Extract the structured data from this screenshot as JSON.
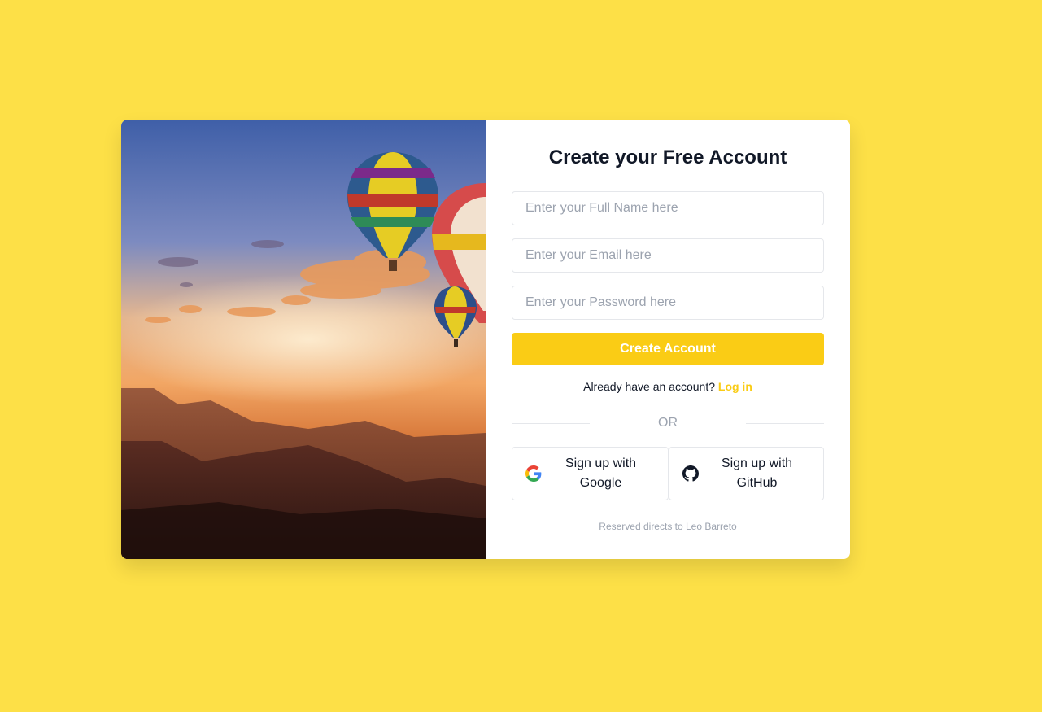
{
  "form": {
    "title": "Create your Free Account",
    "name_placeholder": "Enter your Full Name here",
    "email_placeholder": "Enter your Email here",
    "password_placeholder": "Enter your Password here",
    "submit_label": "Create Account",
    "login_prompt": "Already have an account?",
    "login_link": "Log in",
    "divider": "OR"
  },
  "social": {
    "google_label": "Sign up with Google",
    "github_label": "Sign up with GitHub",
    "google_icon": "google-icon",
    "github_icon": "github-icon"
  },
  "footer": {
    "text": "Reserved directs to Leo Barreto"
  },
  "colors": {
    "background": "#fde047",
    "accent": "#facc15",
    "text": "#111827",
    "muted": "#9ca3af"
  }
}
